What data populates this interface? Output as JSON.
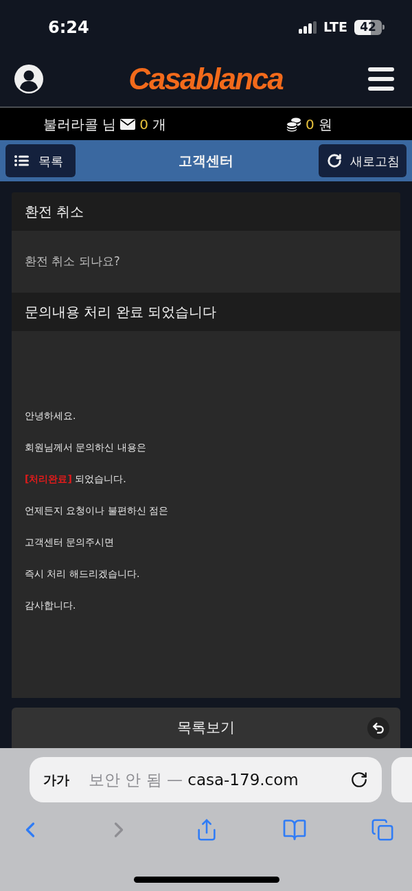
{
  "status_bar": {
    "time": "6:24",
    "network": "LTE",
    "battery": "42"
  },
  "header": {
    "logo": "Casablanca"
  },
  "user_bar": {
    "name": "불러라콜 님",
    "message_count": "0",
    "message_unit": "개",
    "balance": "0",
    "balance_unit": "원"
  },
  "nav_bar": {
    "left_button": "목록",
    "title": "고객센터",
    "right_button": "새로고침"
  },
  "inquiry": {
    "title": "환전 취소",
    "question": "환전 취소 되나요?"
  },
  "answer": {
    "title": "문의내용 처리 완료 되었습니다",
    "lines": [
      {
        "segments": [
          {
            "text": "안녕하세요.",
            "kind": "plain"
          }
        ]
      },
      {
        "segments": [
          {
            "text": "회원님께서 문의하신 내용은",
            "kind": "plain"
          }
        ]
      },
      {
        "segments": [
          {
            "text": "[처리완료]",
            "kind": "status"
          },
          {
            "text": " 되었습니다.",
            "kind": "plain"
          }
        ]
      },
      {
        "segments": [
          {
            "text": "언제든지 요청이나 불편하신 점은",
            "kind": "plain"
          }
        ]
      },
      {
        "segments": [
          {
            "text": "고객센터 문의주시면",
            "kind": "plain"
          }
        ]
      },
      {
        "segments": [
          {
            "text": "즉시 처리 해드리겠습니다.",
            "kind": "plain"
          }
        ]
      },
      {
        "segments": [
          {
            "text": "감사합니다.",
            "kind": "plain"
          }
        ]
      }
    ]
  },
  "list_button": {
    "label": "목록보기"
  },
  "browser": {
    "text_size_button": "가가",
    "security": "보안 안 됨",
    "separator": "—",
    "domain": "casa-179.com",
    "toolbar": [
      {
        "kind": "back",
        "disabled": false
      },
      {
        "kind": "forward",
        "disabled": true
      },
      {
        "kind": "share",
        "disabled": false
      },
      {
        "kind": "bookmarks",
        "disabled": false
      },
      {
        "kind": "tabs",
        "disabled": false
      }
    ]
  }
}
